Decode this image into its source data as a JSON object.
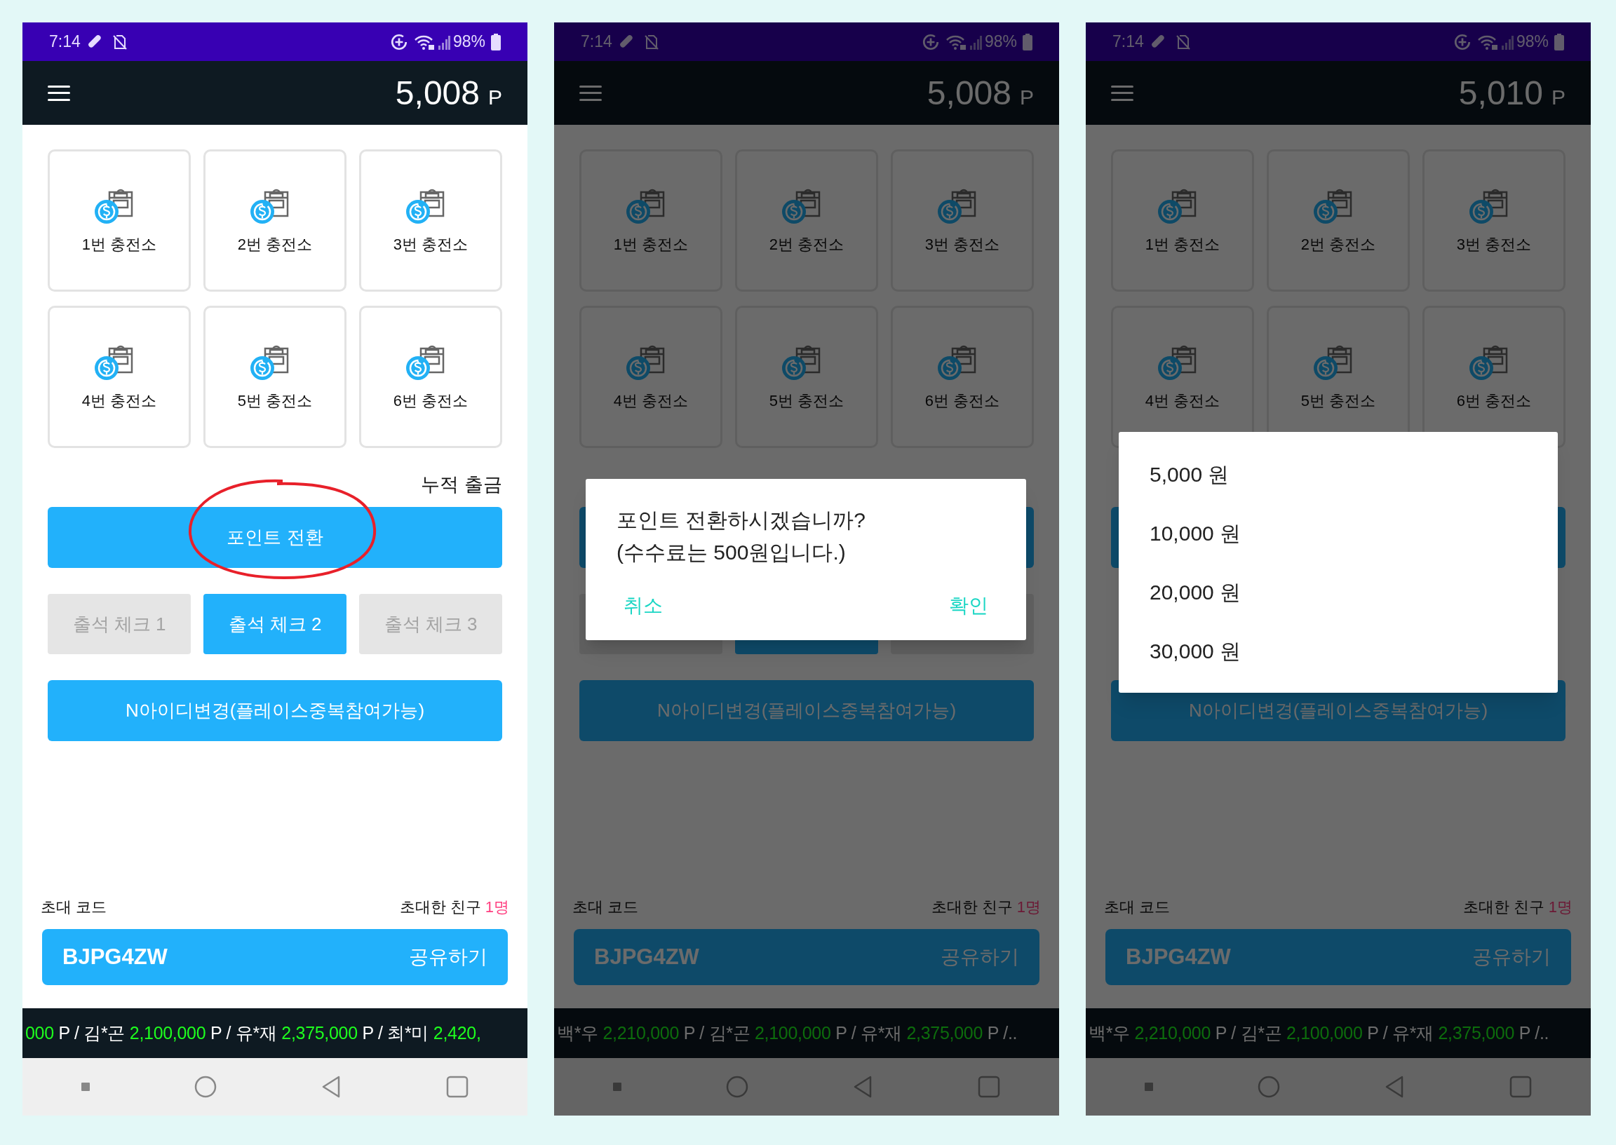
{
  "phones": [
    {
      "status_bar": {
        "time": "7:14",
        "battery": "98%"
      },
      "points": "5,008",
      "points_unit": "P",
      "dimmed": false,
      "annotation_circle": true,
      "stations": [
        "1번 충전소",
        "2번 충전소",
        "3번 충전소",
        "4번 충전소",
        "5번 충전소",
        "6번 충전소"
      ],
      "withdraw_label": "누적 출금",
      "convert_button": "포인트 전환",
      "attendance": [
        {
          "label": "출석 체크 1",
          "disabled": true
        },
        {
          "label": "출석 체크 2",
          "disabled": false
        },
        {
          "label": "출석 체크 3",
          "disabled": true
        }
      ],
      "id_change_button": "N아이디변경(플레이스중복참여가능)",
      "invite_label": "초대 코드",
      "invited_friends_label": "초대한 친구",
      "invited_friends_count": "1명",
      "invite_code": "BJPG4ZW",
      "share_button": "공유하기",
      "ticker": [
        {
          "text": "000",
          "highlight": true
        },
        {
          "text": " P / 김*곤 ",
          "highlight": false
        },
        {
          "text": "2,100,000",
          "highlight": true
        },
        {
          "text": " P / 유*재 ",
          "highlight": false
        },
        {
          "text": "2,375,000",
          "highlight": true
        },
        {
          "text": " P / 최*미 ",
          "highlight": false
        },
        {
          "text": "2,420,",
          "highlight": true
        }
      ]
    },
    {
      "status_bar": {
        "time": "7:14",
        "battery": "98%"
      },
      "points": "5,008",
      "points_unit": "P",
      "dimmed": true,
      "annotation_circle": false,
      "stations": [
        "1번 충전소",
        "2번 충전소",
        "3번 충전소",
        "4번 충전소",
        "5번 충전소",
        "6번 충전소"
      ],
      "attendance": [
        {
          "disabled": true
        },
        {
          "disabled": false
        },
        {
          "disabled": true
        }
      ],
      "id_change_button": "N아이디변경(플레이스중복참여가능)",
      "invite_label": "초대 코드",
      "invited_friends_label": "초대한 친구",
      "invited_friends_count": "1명",
      "invite_code": "BJPG4ZW",
      "share_button": "공유하기",
      "ticker": [
        {
          "text": "백*우 ",
          "highlight": false
        },
        {
          "text": "2,210,000",
          "highlight": true
        },
        {
          "text": " P / 김*곤 ",
          "highlight": false
        },
        {
          "text": "2,100,000",
          "highlight": true
        },
        {
          "text": " P / 유*재 ",
          "highlight": false
        },
        {
          "text": "2,375,000",
          "highlight": true
        },
        {
          "text": " P /..",
          "highlight": false
        }
      ],
      "dialog": {
        "kind": "confirm",
        "message_lines": [
          "포인트 전환하시겠습니까?",
          "(수수료는 500원입니다.)"
        ],
        "cancel": "취소",
        "confirm": "확인"
      }
    },
    {
      "status_bar": {
        "time": "7:14",
        "battery": "98%"
      },
      "points": "5,010",
      "points_unit": "P",
      "dimmed": true,
      "annotation_circle": false,
      "stations": [
        "1번 충전소",
        "2번 충전소",
        "3번 충전소",
        "4번 충전소",
        "5번 충전소",
        "6번 충전소"
      ],
      "id_change_button": "N아이디변경(플레이스중복참여가능)",
      "invite_label": "초대 코드",
      "invited_friends_label": "초대한 친구",
      "invited_friends_count": "1명",
      "invite_code": "BJPG4ZW",
      "share_button": "공유하기",
      "ticker": [
        {
          "text": "백*우 ",
          "highlight": false
        },
        {
          "text": "2,210,000",
          "highlight": true
        },
        {
          "text": " P / 김*곤 ",
          "highlight": false
        },
        {
          "text": "2,100,000",
          "highlight": true
        },
        {
          "text": " P / 유*재 ",
          "highlight": false
        },
        {
          "text": "2,375,000",
          "highlight": true
        },
        {
          "text": " P /..",
          "highlight": false
        }
      ],
      "dialog": {
        "kind": "menu",
        "options": [
          "5,000 원",
          "10,000 원",
          "20,000 원",
          "30,000 원"
        ]
      }
    }
  ]
}
